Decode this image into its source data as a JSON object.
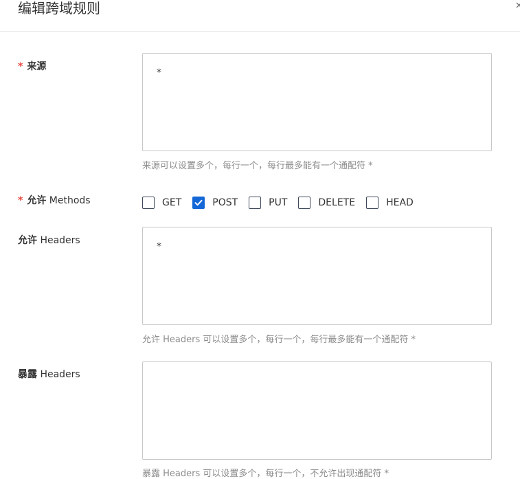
{
  "dialog": {
    "title": "编辑跨域规则",
    "close_icon": "close-icon"
  },
  "fields": {
    "origin": {
      "required_mark": "*",
      "label": "来源",
      "value": "*",
      "help": "来源可以设置多个，每行一个，每行最多能有一个通配符 *"
    },
    "methods": {
      "required_mark": "*",
      "label_cn": "允许",
      "label_en": " Methods",
      "options": [
        {
          "label": "GET",
          "checked": false
        },
        {
          "label": "POST",
          "checked": true
        },
        {
          "label": "PUT",
          "checked": false
        },
        {
          "label": "DELETE",
          "checked": false
        },
        {
          "label": "HEAD",
          "checked": false
        }
      ]
    },
    "allow_headers": {
      "label_cn": "允许",
      "label_en": " Headers",
      "value": "*",
      "help": "允许 Headers 可以设置多个，每行一个，每行最多能有一个通配符 *"
    },
    "expose_headers": {
      "label_cn": "暴露",
      "label_en": " Headers",
      "value": "",
      "help": "暴露 Headers 可以设置多个，每行一个，不允许出现通配符 *"
    }
  },
  "colors": {
    "required": "#e8483f",
    "checkbox_checked": "#1467d6",
    "help_text": "#8c8c8c",
    "border": "#c8c8c8"
  }
}
